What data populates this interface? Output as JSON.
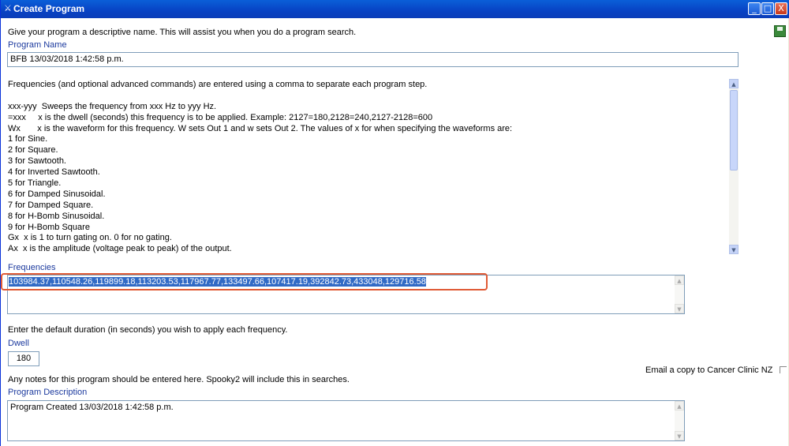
{
  "window": {
    "title": "Create Program",
    "minimize": "_",
    "maximize": "□",
    "close": "X"
  },
  "intro": "Give your program a descriptive name. This will assist you when you do a program search.",
  "program_name": {
    "label": "Program Name",
    "value": "BFB 13/03/2018 1:42:58 p.m."
  },
  "help_lines": [
    "Frequencies (and optional advanced commands) are entered using a comma to separate each program step.",
    "",
    "xxx-yyy  Sweeps the frequency from xxx Hz to yyy Hz.",
    "=xxx     x is the dwell (seconds) this frequency is to be applied. Example: 2127=180,2128=240,2127-2128=600",
    "Wx       x is the waveform for this frequency. W sets Out 1 and w sets Out 2. The values of x for when specifying the waveforms are:",
    "1 for Sine.",
    "2 for Square.",
    "3 for Sawtooth.",
    "4 for Inverted Sawtooth.",
    "5 for Triangle.",
    "6 for Damped Sinusoidal.",
    "7 for Damped Square.",
    "8 for H-Bomb Sinusoidal.",
    "9 for H-Bomb Square",
    "Gx  x is 1 to turn gating on. 0 for no gating.",
    "Ax  x is the amplitude (voltage peak to peak) of the output."
  ],
  "frequencies": {
    "label": "Frequencies",
    "value": "103984.37,110548.26,119899.18,113203.53,117967.77,133497.66,107417.19,392842.73,433048,129716.58"
  },
  "dwell": {
    "hint": "Enter the default duration (in seconds) you wish to apply each frequency.",
    "label": "Dwell",
    "value": "180"
  },
  "email": {
    "label": "Email a copy to Cancer Clinic NZ"
  },
  "notes_hint": "Any notes for this program should be entered here. Spooky2 will include this in searches.",
  "description": {
    "label": "Program Description",
    "value": "Program Created 13/03/2018 1:42:58 p.m."
  },
  "colors": {
    "titlebar": "#0a5fd8",
    "label_blue": "#1c3a9e",
    "selection": "#316ac5",
    "highlight_box": "#e05a35"
  }
}
